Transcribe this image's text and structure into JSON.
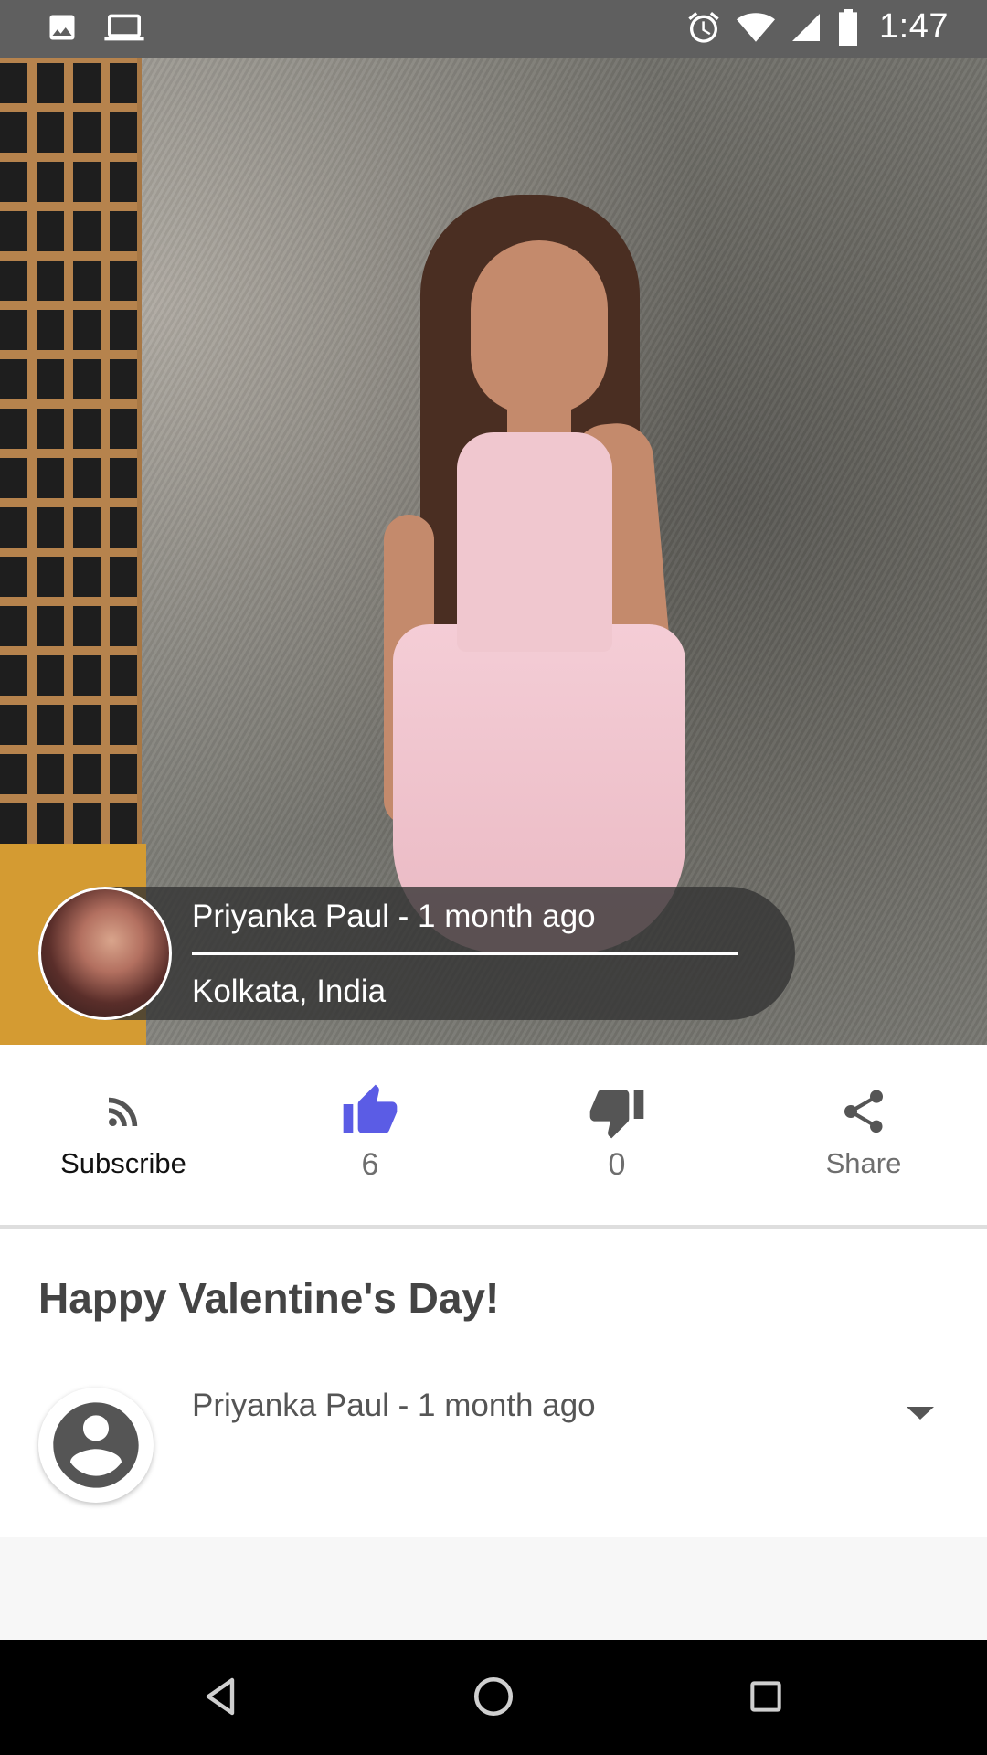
{
  "status_bar": {
    "time": "1:47",
    "left_icons": [
      "image-icon",
      "laptop-icon"
    ],
    "right_icons": [
      "alarm-icon",
      "wifi-icon",
      "signal-icon",
      "battery-icon"
    ]
  },
  "post": {
    "author": {
      "name_time": "Priyanka Paul - 1 month ago",
      "location": "Kolkata, India"
    },
    "title": "Happy Valentine's Day!"
  },
  "actions": {
    "subscribe_label": "Subscribe",
    "like_count": "6",
    "dislike_count": "0",
    "share_label": "Share",
    "colors": {
      "like_active": "#5b5ce5",
      "icon_gray": "#555555",
      "text_dark": "#111111",
      "text_gray": "#6e6e6e"
    }
  },
  "comment": {
    "meta": "Priyanka Paul - 1 month ago"
  },
  "nav": {
    "buttons": [
      "back-icon",
      "home-icon",
      "recents-icon"
    ]
  }
}
